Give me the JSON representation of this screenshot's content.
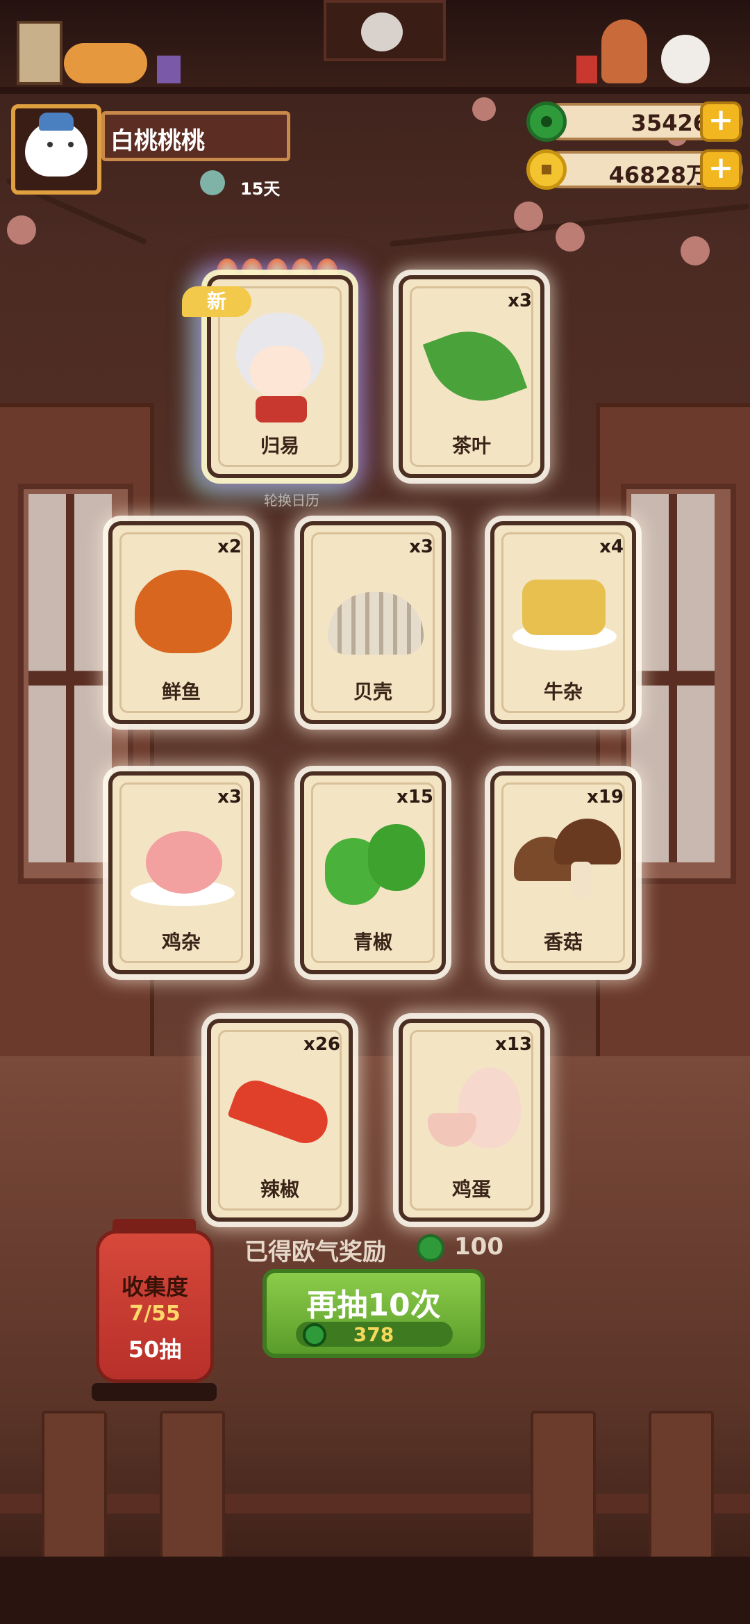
{
  "player": {
    "name": "白桃桃桃",
    "days": "15天"
  },
  "currency": {
    "jade": "35426",
    "coins": "46828万",
    "plus": "+"
  },
  "cards": [
    {
      "name": "归易",
      "qty": "",
      "is_new": true,
      "new_label": "新",
      "stars": 5
    },
    {
      "name": "茶叶",
      "qty": "x3"
    },
    {
      "name": "鲜鱼",
      "qty": "x2"
    },
    {
      "name": "贝壳",
      "qty": "x3"
    },
    {
      "name": "牛杂",
      "qty": "x4"
    },
    {
      "name": "鸡杂",
      "qty": "x3"
    },
    {
      "name": "青椒",
      "qty": "x15"
    },
    {
      "name": "香菇",
      "qty": "x19"
    },
    {
      "name": "辣椒",
      "qty": "x26"
    },
    {
      "name": "鸡蛋",
      "qty": "x13"
    }
  ],
  "background": {
    "calendar_label": "轮换日历"
  },
  "reward": {
    "label": "已得欧气奖励",
    "amount": "100"
  },
  "draw_button": {
    "label": "再抽10次",
    "cost": "378"
  },
  "collection": {
    "title": "收集度",
    "progress": "7/55",
    "draws": "50抽"
  },
  "colors": {
    "jade": "#2e9a3a",
    "coin": "#f4c430",
    "button_green": "#6fb03a",
    "lantern_red": "#c8382e"
  }
}
